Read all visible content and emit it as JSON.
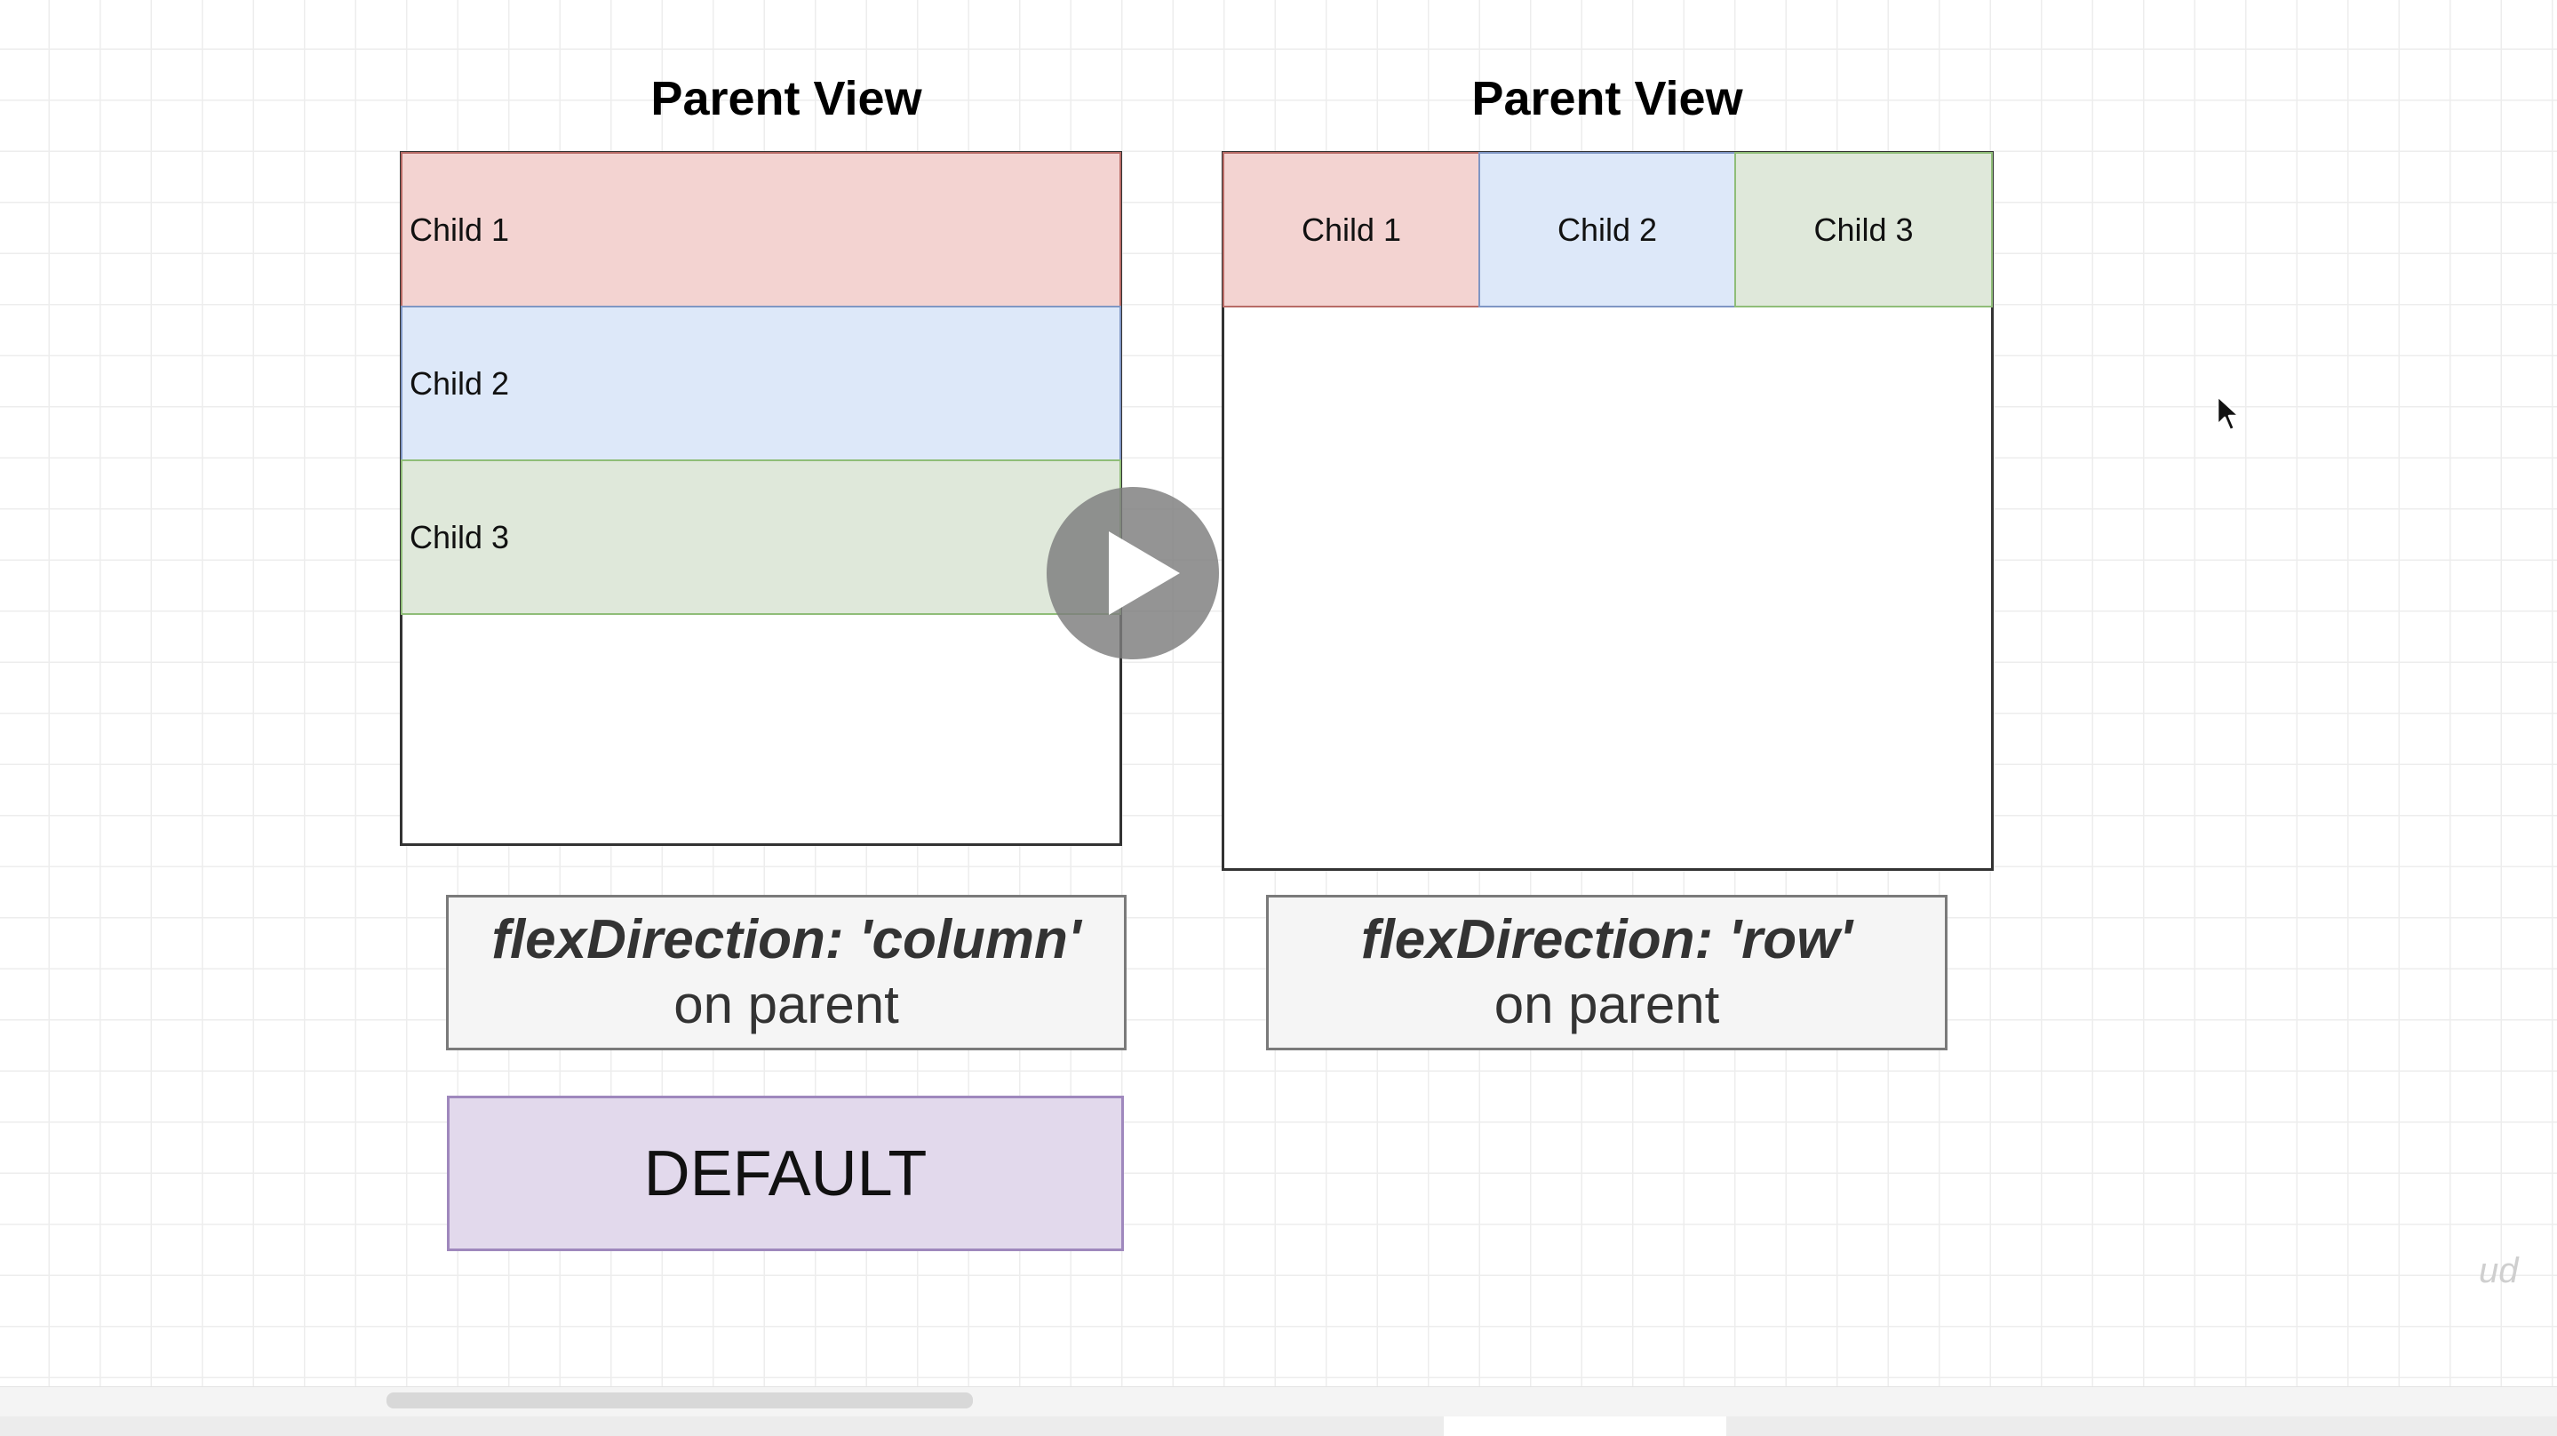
{
  "left_diagram": {
    "title": "Parent View",
    "children": [
      "Child 1",
      "Child 2",
      "Child 3"
    ],
    "caption_code": "flexDirection: 'column'",
    "caption_sub": "on parent",
    "badge": "DEFAULT"
  },
  "right_diagram": {
    "title": "Parent View",
    "children": [
      "Child 1",
      "Child 2",
      "Child 3"
    ],
    "caption_code": "flexDirection: 'row'",
    "caption_sub": "on parent"
  },
  "video": {
    "play_icon": "play-icon",
    "cursor_icon": "cursor-icon"
  },
  "watermark": "ud",
  "colors": {
    "child1": "#f3d3d1",
    "child2": "#dde8f9",
    "child3": "#dfe8da",
    "default_badge": "#e2d9ec",
    "grid": "#ededed"
  }
}
